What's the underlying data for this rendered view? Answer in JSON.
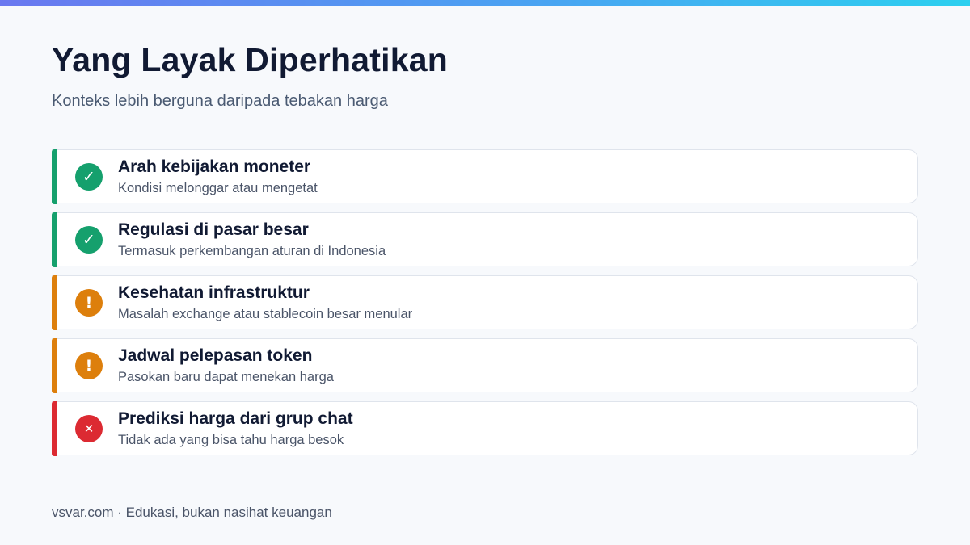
{
  "title": "Yang Layak Diperhatikan",
  "subtitle": "Konteks lebih berguna daripada tebakan harga",
  "colors": {
    "green": "#15a06d",
    "amber": "#dd7f0c",
    "red": "#dc2a32"
  },
  "items": [
    {
      "status": "green",
      "icon": "check-icon",
      "glyph": "✓",
      "title": "Arah kebijakan moneter",
      "desc": "Kondisi melonggar atau mengetat"
    },
    {
      "status": "green",
      "icon": "check-icon",
      "glyph": "✓",
      "title": "Regulasi di pasar besar",
      "desc": "Termasuk perkembangan aturan di Indonesia"
    },
    {
      "status": "amber",
      "icon": "exclamation-icon",
      "glyph": "!",
      "title": "Kesehatan infrastruktur",
      "desc": "Masalah exchange atau stablecoin besar menular"
    },
    {
      "status": "amber",
      "icon": "exclamation-icon",
      "glyph": "!",
      "title": "Jadwal pelepasan token",
      "desc": "Pasokan baru dapat menekan harga"
    },
    {
      "status": "red",
      "icon": "cross-icon",
      "glyph": "✕",
      "title": "Prediksi harga dari grup chat",
      "desc": "Tidak ada yang bisa tahu harga besok"
    }
  ],
  "footer": "vsvar.com · Edukasi, bukan nasihat keuangan"
}
